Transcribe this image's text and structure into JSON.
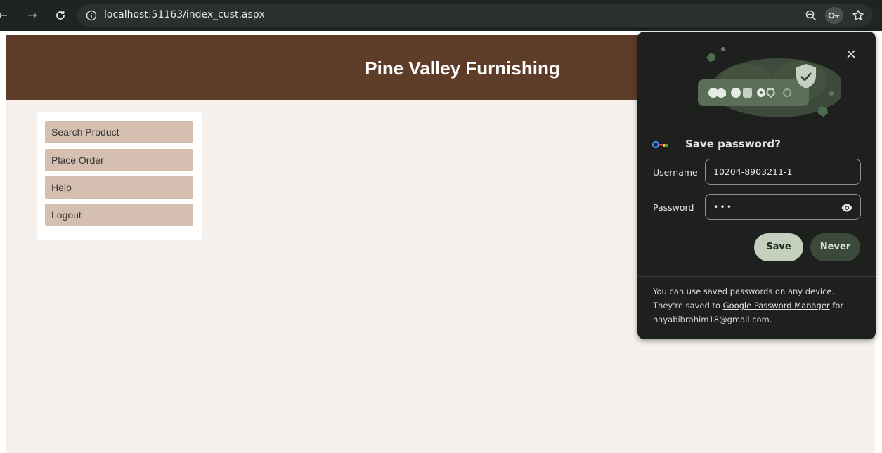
{
  "browser": {
    "back_glyph": "←",
    "forward_glyph": "→",
    "url": "localhost:51163/index_cust.aspx",
    "icons": [
      "back-icon",
      "forward-icon",
      "reload-icon",
      "site-info-icon",
      "zoom-icon",
      "password-key-icon",
      "bookmark-star-icon"
    ]
  },
  "page": {
    "title": "Pine Valley Furnishing",
    "header_color": "#5d3d28",
    "background_color": "#f5f0eb"
  },
  "sidebar": {
    "items": [
      {
        "label": "Search Product"
      },
      {
        "label": "Place Order"
      },
      {
        "label": "Help"
      },
      {
        "label": "Logout"
      }
    ]
  },
  "password_popup": {
    "title": "Save password?",
    "username_label": "Username",
    "username_value": "10204-8903211-1",
    "password_label": "Password",
    "password_value": "•••",
    "save_label": "Save",
    "never_label": "Never",
    "footer_text_before": "You can use saved passwords on any device. They're saved to ",
    "footer_link": "Google Password Manager",
    "footer_text_after": " for nayabibrahim18@gmail.com."
  }
}
